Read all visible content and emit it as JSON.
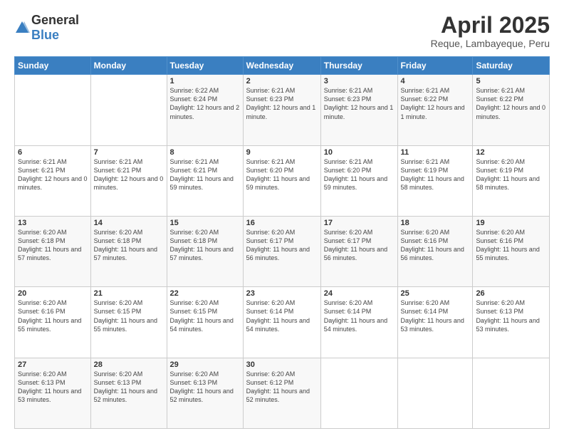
{
  "header": {
    "logo_general": "General",
    "logo_blue": "Blue",
    "title": "April 2025",
    "subtitle": "Reque, Lambayeque, Peru"
  },
  "days_of_week": [
    "Sunday",
    "Monday",
    "Tuesday",
    "Wednesday",
    "Thursday",
    "Friday",
    "Saturday"
  ],
  "weeks": [
    [
      {
        "day": "",
        "sunrise": "",
        "sunset": "",
        "daylight": ""
      },
      {
        "day": "",
        "sunrise": "",
        "sunset": "",
        "daylight": ""
      },
      {
        "day": "1",
        "sunrise": "Sunrise: 6:22 AM",
        "sunset": "Sunset: 6:24 PM",
        "daylight": "Daylight: 12 hours and 2 minutes."
      },
      {
        "day": "2",
        "sunrise": "Sunrise: 6:21 AM",
        "sunset": "Sunset: 6:23 PM",
        "daylight": "Daylight: 12 hours and 1 minute."
      },
      {
        "day": "3",
        "sunrise": "Sunrise: 6:21 AM",
        "sunset": "Sunset: 6:23 PM",
        "daylight": "Daylight: 12 hours and 1 minute."
      },
      {
        "day": "4",
        "sunrise": "Sunrise: 6:21 AM",
        "sunset": "Sunset: 6:22 PM",
        "daylight": "Daylight: 12 hours and 1 minute."
      },
      {
        "day": "5",
        "sunrise": "Sunrise: 6:21 AM",
        "sunset": "Sunset: 6:22 PM",
        "daylight": "Daylight: 12 hours and 0 minutes."
      }
    ],
    [
      {
        "day": "6",
        "sunrise": "Sunrise: 6:21 AM",
        "sunset": "Sunset: 6:21 PM",
        "daylight": "Daylight: 12 hours and 0 minutes."
      },
      {
        "day": "7",
        "sunrise": "Sunrise: 6:21 AM",
        "sunset": "Sunset: 6:21 PM",
        "daylight": "Daylight: 12 hours and 0 minutes."
      },
      {
        "day": "8",
        "sunrise": "Sunrise: 6:21 AM",
        "sunset": "Sunset: 6:21 PM",
        "daylight": "Daylight: 11 hours and 59 minutes."
      },
      {
        "day": "9",
        "sunrise": "Sunrise: 6:21 AM",
        "sunset": "Sunset: 6:20 PM",
        "daylight": "Daylight: 11 hours and 59 minutes."
      },
      {
        "day": "10",
        "sunrise": "Sunrise: 6:21 AM",
        "sunset": "Sunset: 6:20 PM",
        "daylight": "Daylight: 11 hours and 59 minutes."
      },
      {
        "day": "11",
        "sunrise": "Sunrise: 6:21 AM",
        "sunset": "Sunset: 6:19 PM",
        "daylight": "Daylight: 11 hours and 58 minutes."
      },
      {
        "day": "12",
        "sunrise": "Sunrise: 6:20 AM",
        "sunset": "Sunset: 6:19 PM",
        "daylight": "Daylight: 11 hours and 58 minutes."
      }
    ],
    [
      {
        "day": "13",
        "sunrise": "Sunrise: 6:20 AM",
        "sunset": "Sunset: 6:18 PM",
        "daylight": "Daylight: 11 hours and 57 minutes."
      },
      {
        "day": "14",
        "sunrise": "Sunrise: 6:20 AM",
        "sunset": "Sunset: 6:18 PM",
        "daylight": "Daylight: 11 hours and 57 minutes."
      },
      {
        "day": "15",
        "sunrise": "Sunrise: 6:20 AM",
        "sunset": "Sunset: 6:18 PM",
        "daylight": "Daylight: 11 hours and 57 minutes."
      },
      {
        "day": "16",
        "sunrise": "Sunrise: 6:20 AM",
        "sunset": "Sunset: 6:17 PM",
        "daylight": "Daylight: 11 hours and 56 minutes."
      },
      {
        "day": "17",
        "sunrise": "Sunrise: 6:20 AM",
        "sunset": "Sunset: 6:17 PM",
        "daylight": "Daylight: 11 hours and 56 minutes."
      },
      {
        "day": "18",
        "sunrise": "Sunrise: 6:20 AM",
        "sunset": "Sunset: 6:16 PM",
        "daylight": "Daylight: 11 hours and 56 minutes."
      },
      {
        "day": "19",
        "sunrise": "Sunrise: 6:20 AM",
        "sunset": "Sunset: 6:16 PM",
        "daylight": "Daylight: 11 hours and 55 minutes."
      }
    ],
    [
      {
        "day": "20",
        "sunrise": "Sunrise: 6:20 AM",
        "sunset": "Sunset: 6:16 PM",
        "daylight": "Daylight: 11 hours and 55 minutes."
      },
      {
        "day": "21",
        "sunrise": "Sunrise: 6:20 AM",
        "sunset": "Sunset: 6:15 PM",
        "daylight": "Daylight: 11 hours and 55 minutes."
      },
      {
        "day": "22",
        "sunrise": "Sunrise: 6:20 AM",
        "sunset": "Sunset: 6:15 PM",
        "daylight": "Daylight: 11 hours and 54 minutes."
      },
      {
        "day": "23",
        "sunrise": "Sunrise: 6:20 AM",
        "sunset": "Sunset: 6:14 PM",
        "daylight": "Daylight: 11 hours and 54 minutes."
      },
      {
        "day": "24",
        "sunrise": "Sunrise: 6:20 AM",
        "sunset": "Sunset: 6:14 PM",
        "daylight": "Daylight: 11 hours and 54 minutes."
      },
      {
        "day": "25",
        "sunrise": "Sunrise: 6:20 AM",
        "sunset": "Sunset: 6:14 PM",
        "daylight": "Daylight: 11 hours and 53 minutes."
      },
      {
        "day": "26",
        "sunrise": "Sunrise: 6:20 AM",
        "sunset": "Sunset: 6:13 PM",
        "daylight": "Daylight: 11 hours and 53 minutes."
      }
    ],
    [
      {
        "day": "27",
        "sunrise": "Sunrise: 6:20 AM",
        "sunset": "Sunset: 6:13 PM",
        "daylight": "Daylight: 11 hours and 53 minutes."
      },
      {
        "day": "28",
        "sunrise": "Sunrise: 6:20 AM",
        "sunset": "Sunset: 6:13 PM",
        "daylight": "Daylight: 11 hours and 52 minutes."
      },
      {
        "day": "29",
        "sunrise": "Sunrise: 6:20 AM",
        "sunset": "Sunset: 6:13 PM",
        "daylight": "Daylight: 11 hours and 52 minutes."
      },
      {
        "day": "30",
        "sunrise": "Sunrise: 6:20 AM",
        "sunset": "Sunset: 6:12 PM",
        "daylight": "Daylight: 11 hours and 52 minutes."
      },
      {
        "day": "",
        "sunrise": "",
        "sunset": "",
        "daylight": ""
      },
      {
        "day": "",
        "sunrise": "",
        "sunset": "",
        "daylight": ""
      },
      {
        "day": "",
        "sunrise": "",
        "sunset": "",
        "daylight": ""
      }
    ]
  ]
}
